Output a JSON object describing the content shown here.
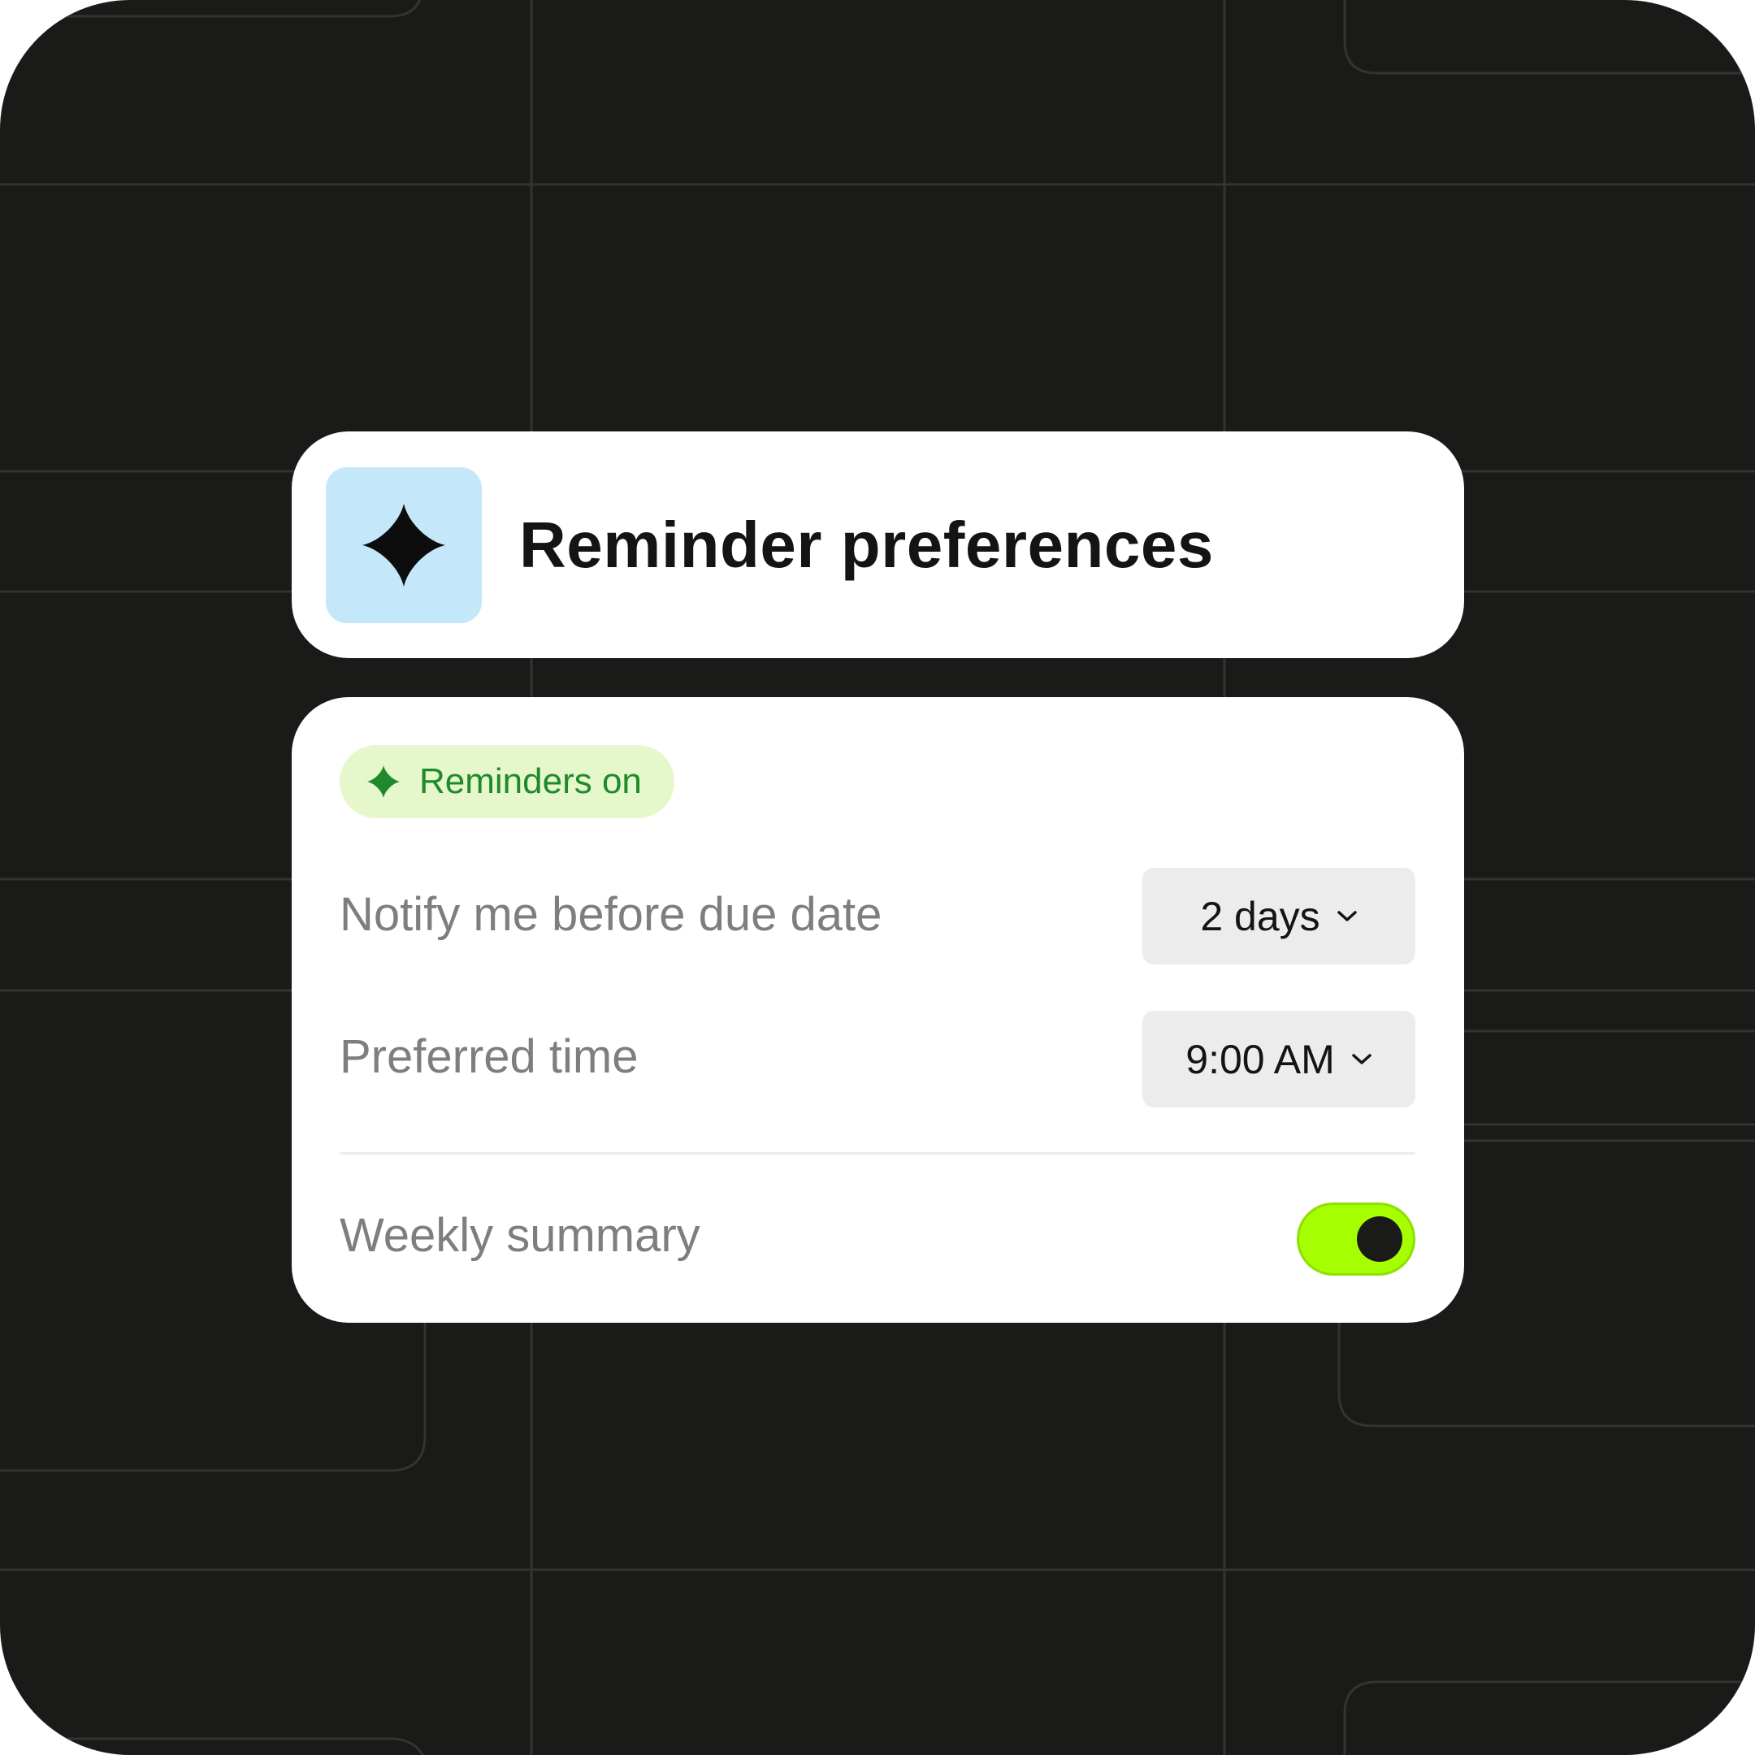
{
  "header": {
    "title": "Reminder preferences",
    "icon": "sparkle-icon"
  },
  "status_badge": {
    "icon": "sparkle-icon",
    "label": "Reminders on"
  },
  "settings": {
    "notify_before": {
      "label": "Notify me before due date",
      "value": "2 days"
    },
    "preferred_time": {
      "label": "Preferred time",
      "value": "9:00 AM"
    },
    "weekly_summary": {
      "label": "Weekly summary",
      "enabled": true
    }
  },
  "colors": {
    "background": "#1a1a19",
    "card": "#ffffff",
    "icon_tile": "#c4e8fa",
    "badge_bg": "#e6f7cc",
    "badge_text": "#1f8a2b",
    "toggle_on": "#a6ff00",
    "select_bg": "#ececec",
    "label_gray": "#7e7e7e"
  }
}
